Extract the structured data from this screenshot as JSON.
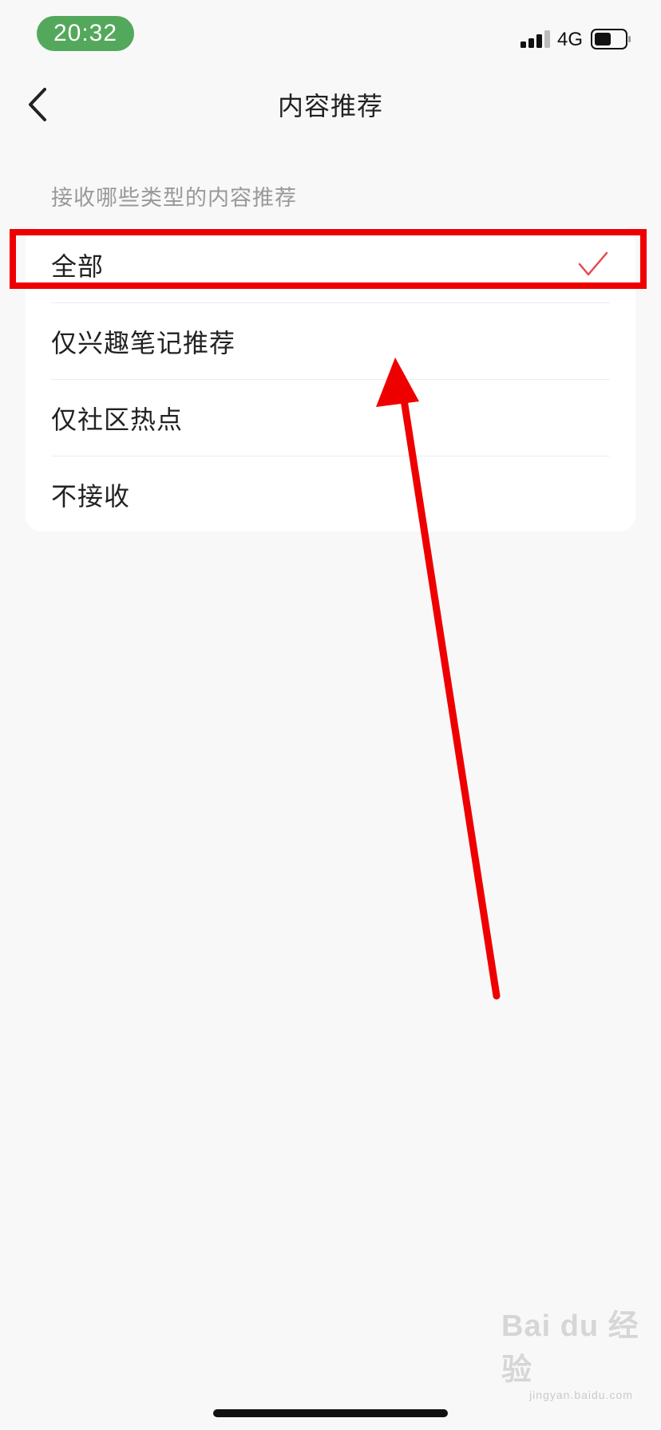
{
  "status_bar": {
    "time": "20:32",
    "network": "4G",
    "signal_icon": "signal-bars-icon",
    "battery_icon": "battery-icon",
    "battery_level": 0.55
  },
  "nav": {
    "back_icon": "chevron-left-icon",
    "title": "内容推荐"
  },
  "section": {
    "label": "接收哪些类型的内容推荐"
  },
  "options": [
    {
      "label": "全部",
      "selected": true
    },
    {
      "label": "仅兴趣笔记推荐",
      "selected": false
    },
    {
      "label": "仅社区热点",
      "selected": false
    },
    {
      "label": "不接收",
      "selected": false
    }
  ],
  "colors": {
    "time_pill": "#54a85b",
    "check": "#e5484d",
    "annotation": "#ee0000",
    "background": "#f8f8f8"
  },
  "watermark": {
    "brand": "Bai du 经验",
    "url": "jingyan.baidu.com"
  }
}
